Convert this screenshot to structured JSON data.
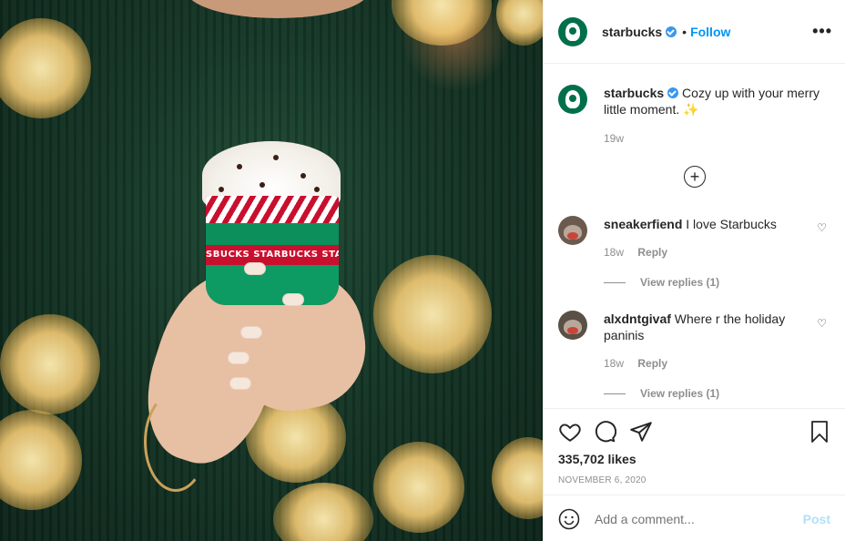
{
  "header": {
    "username": "starbucks",
    "separator": "•",
    "follow_label": "Follow",
    "more_label": "•••"
  },
  "caption": {
    "username": "starbucks",
    "text": "Cozy up with your merry little moment.",
    "emoji": "✨",
    "age": "19w"
  },
  "load_more": {
    "label": "+"
  },
  "comments": [
    {
      "username": "sneakerfiend",
      "text": "I love Starbucks",
      "age": "18w",
      "reply_label": "Reply",
      "view_replies": "View replies (1)"
    },
    {
      "username": "alxdntgivaf",
      "text": "Where r the holiday paninis",
      "age": "18w",
      "reply_label": "Reply",
      "view_replies": "View replies (1)"
    }
  ],
  "stats": {
    "likes": "335,702 likes",
    "date": "NOVEMBER 6, 2020"
  },
  "composer": {
    "placeholder": "Add a comment...",
    "post_label": "Post"
  },
  "photo": {
    "cup_text": "SBUCKS   STARBUCKS   STA"
  },
  "colors": {
    "accent": "#0095f6",
    "verified": "#3897f0",
    "brand_green": "#00704a",
    "muted": "#8e8e8e",
    "post_disabled": "#b2dffc"
  }
}
